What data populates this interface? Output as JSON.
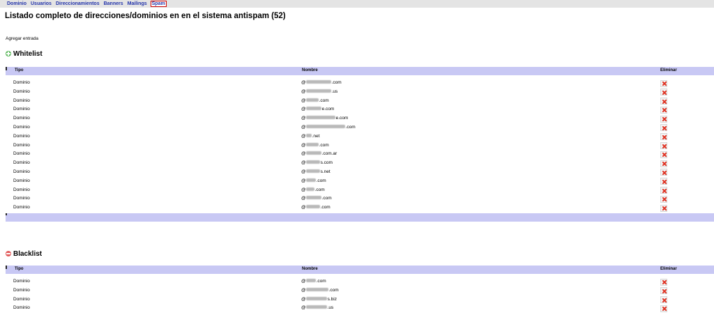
{
  "nav": {
    "items": [
      {
        "label": "Dominio",
        "active": false
      },
      {
        "label": "Usuarios",
        "active": false
      },
      {
        "label": "Direccionamientos",
        "active": false
      },
      {
        "label": "Banners",
        "active": false
      },
      {
        "label": "Mailings",
        "active": false
      },
      {
        "label": "Spam",
        "active": true
      }
    ]
  },
  "page": {
    "title": "Listado completo de direcciones/dominios en en el sistema antispam (52)",
    "add_link": "Agregar entrada"
  },
  "columns": {
    "tipo": "Tipo",
    "nombre": "Nombre",
    "eliminar": "Eliminar"
  },
  "whitelist": {
    "title": "Whitelist",
    "rows": [
      {
        "tipo": "Dominio",
        "at": "@",
        "blur": 36,
        "suffix": ".com"
      },
      {
        "tipo": "Dominio",
        "at": "@",
        "blur": 36,
        "suffix": ".us"
      },
      {
        "tipo": "Dominio",
        "at": "@",
        "blur": 18,
        "suffix": ".com"
      },
      {
        "tipo": "Dominio",
        "at": "@",
        "blur": 22,
        "suffix": "e.com"
      },
      {
        "tipo": "Dominio",
        "at": "@",
        "blur": 42,
        "suffix": "e.com"
      },
      {
        "tipo": "Dominio",
        "at": "@",
        "blur": 56,
        "suffix": ".com"
      },
      {
        "tipo": "Dominio",
        "at": "@",
        "blur": 8,
        "suffix": ".net"
      },
      {
        "tipo": "Dominio",
        "at": "@",
        "blur": 18,
        "suffix": ".com"
      },
      {
        "tipo": "Dominio",
        "at": "@",
        "blur": 22,
        "suffix": ".com.ar"
      },
      {
        "tipo": "Dominio",
        "at": "@",
        "blur": 20,
        "suffix": "s.com"
      },
      {
        "tipo": "Dominio",
        "at": "@",
        "blur": 20,
        "suffix": "s.net"
      },
      {
        "tipo": "Dominio",
        "at": "@",
        "blur": 14,
        "suffix": ".com"
      },
      {
        "tipo": "Dominio",
        "at": "@",
        "blur": 12,
        "suffix": ".com"
      },
      {
        "tipo": "Dominio",
        "at": "@",
        "blur": 22,
        "suffix": ".com"
      },
      {
        "tipo": "Dominio",
        "at": "@",
        "blur": 20,
        "suffix": ".com"
      }
    ]
  },
  "blacklist": {
    "title": "Blacklist",
    "rows": [
      {
        "tipo": "Dominio",
        "at": "@",
        "blur": 14,
        "suffix": ".com"
      },
      {
        "tipo": "Dominio",
        "at": "@",
        "blur": 32,
        "suffix": ".com"
      },
      {
        "tipo": "Dominio",
        "at": "@",
        "blur": 30,
        "suffix": "s.biz"
      },
      {
        "tipo": "Dominio",
        "at": "@",
        "blur": 30,
        "suffix": ".us"
      }
    ]
  },
  "icons": {
    "add": "plus-icon",
    "remove": "minus-icon",
    "delete": "delete-x-icon"
  },
  "colors": {
    "nav_link": "#2233aa",
    "table_header": "#c8c8f4",
    "active_border": "#cc0000",
    "delete_x": "#e03020"
  }
}
